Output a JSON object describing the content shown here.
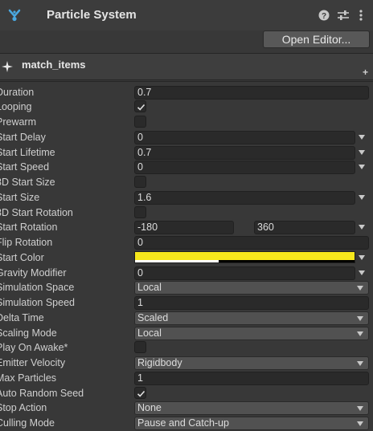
{
  "header": {
    "title": "Particle System"
  },
  "toolbar": {
    "open_editor_label": "Open Editor..."
  },
  "module": {
    "name": "match_items",
    "add_label": "+"
  },
  "fields": {
    "duration": {
      "label": "Duration",
      "value": "0.7"
    },
    "looping": {
      "label": "Looping",
      "checked": true
    },
    "prewarm": {
      "label": "Prewarm",
      "checked": false
    },
    "start_delay": {
      "label": "Start Delay",
      "value": "0"
    },
    "start_lifetime": {
      "label": "Start Lifetime",
      "value": "0.7"
    },
    "start_speed": {
      "label": "Start Speed",
      "value": "0"
    },
    "three_d_start_size": {
      "label": "3D Start Size",
      "checked": false
    },
    "start_size": {
      "label": "Start Size",
      "value": "1.6"
    },
    "three_d_start_rotation": {
      "label": "3D Start Rotation",
      "checked": false
    },
    "start_rotation": {
      "label": "Start Rotation",
      "min": "-180",
      "max": "360"
    },
    "flip_rotation": {
      "label": "Flip Rotation",
      "value": "0"
    },
    "start_color": {
      "label": "Start Color",
      "color": "#f7e81c",
      "alpha_fraction": 0.38
    },
    "gravity_modifier": {
      "label": "Gravity Modifier",
      "value": "0"
    },
    "simulation_space": {
      "label": "Simulation Space",
      "value": "Local"
    },
    "simulation_speed": {
      "label": "Simulation Speed",
      "value": "1"
    },
    "delta_time": {
      "label": "Delta Time",
      "value": "Scaled"
    },
    "scaling_mode": {
      "label": "Scaling Mode",
      "value": "Local"
    },
    "play_on_awake": {
      "label": "Play On Awake*",
      "checked": false
    },
    "emitter_velocity": {
      "label": "Emitter Velocity",
      "value": "Rigidbody"
    },
    "max_particles": {
      "label": "Max Particles",
      "value": "1"
    },
    "auto_random_seed": {
      "label": "Auto Random Seed",
      "checked": true
    },
    "stop_action": {
      "label": "Stop Action",
      "value": "None"
    },
    "culling_mode": {
      "label": "Culling Mode",
      "value": "Pause and Catch-up"
    }
  },
  "icons": {
    "component": "particle-system-icon",
    "help": "help-icon",
    "presets": "presets-icon",
    "menu": "kebab-menu-icon"
  },
  "colors": {
    "accent_blue": "#4aa8e0",
    "start_color": "#f7e81c"
  }
}
